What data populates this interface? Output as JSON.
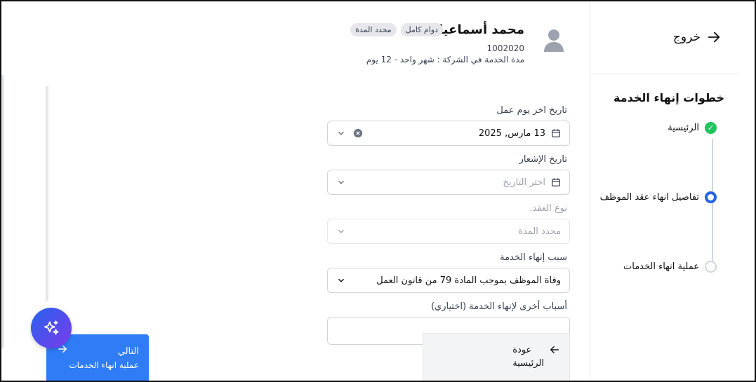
{
  "sidebar": {
    "exit_label": "خروج",
    "steps_title": "خطوات إنهاء الخدمة",
    "steps": [
      {
        "label": "الرئيسية",
        "state": "done"
      },
      {
        "label": "تفاصيل انهاء عقد الموظف",
        "state": "active"
      },
      {
        "label": "عملية انهاء الخدمات",
        "state": "pending"
      }
    ]
  },
  "employee": {
    "name": "محمد أسماعيل",
    "badges": [
      "دوام كامل",
      "محدد المدة"
    ],
    "id": "1002020",
    "service_duration": "مدة الخدمة في الشركة : شهر واحد - 12 يوم"
  },
  "form": {
    "last_day_label": "تاريخ اخر يوم عمل",
    "last_day_value": "13 مارس, 2025",
    "notice_label": "تاريخ الإشعار",
    "notice_placeholder": "اختر التاريخ",
    "contract_type_label": "نوع العقد.",
    "contract_type_value": "محدد المدة",
    "reason_label": "سبب إنهاء الخدمة",
    "reason_value": "وفاة الموظف بموجب المادة 79 من قانون العمل",
    "other_reasons_label": "أسباب أخرى لإنهاء الخدمة (اختياري)",
    "other_reasons_value": ""
  },
  "footer": {
    "back_line1": "عودة",
    "back_line2": "الرئيسية",
    "next_line1": "التالي",
    "next_line2": "عملية انهاء الخدمات"
  },
  "colors": {
    "primary": "#2f7cf6",
    "active_step": "#2563eb",
    "done_step": "#22c55e",
    "ai_gradient_start": "#2563eb",
    "ai_gradient_end": "#7c3aed"
  }
}
